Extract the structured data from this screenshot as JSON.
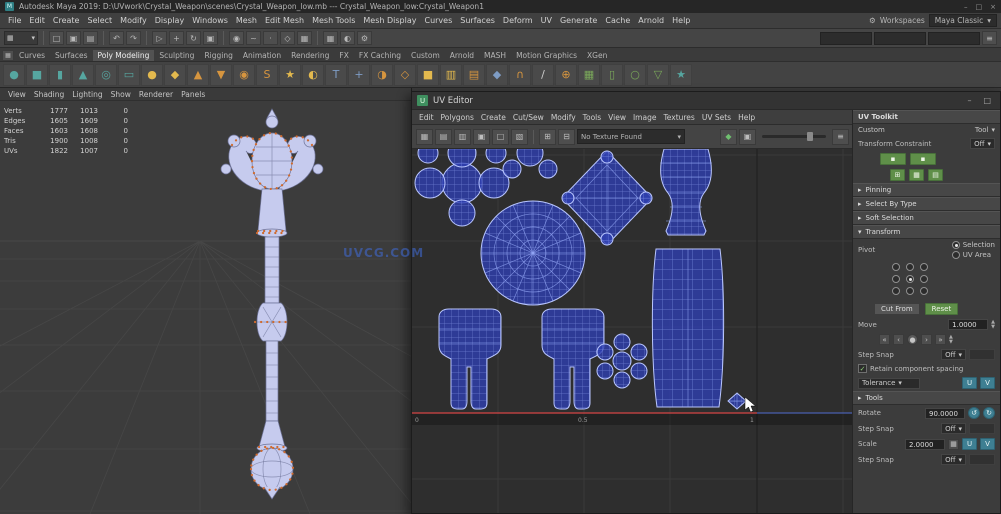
{
  "colors": {
    "shell_fill": "#2e3fb0",
    "shell_line": "#b9c6ff",
    "axis_red": "#b84040",
    "accent_green": "#5f8f49",
    "accent_teal": "#3e7f92",
    "icon_orange": "#d6953f",
    "icon_amber": "#e3b94e",
    "icon_teal": "#56a6a0",
    "icon_blue": "#7e9cc4",
    "watermark_blue": "#3f6cd8"
  },
  "glyphs": {
    "dropdown": "▾",
    "collapsed": "▸",
    "expanded": "▾",
    "up": "▲",
    "down": "▼",
    "chev_left": "‹",
    "chev_right": "›",
    "chev_left2": "«",
    "chev_right2": "»",
    "center_dot": "●",
    "check": "✓",
    "rotate_ccw": "↺",
    "rotate_cw": "↻",
    "minimize": "–",
    "maximize": "□",
    "close": "×",
    "gear": "⚙",
    "grid": "▦",
    "slider_more": "≡"
  },
  "window": {
    "app_icon": "M",
    "title": "Autodesk Maya 2019: D:\\UVwork\\Crystal_Weapon\\scenes\\Crystal_Weapon_low.mb --- Crystal_Weapon_low:Crystal_Weapon1"
  },
  "menubar": {
    "items": [
      "File",
      "Edit",
      "Create",
      "Select",
      "Modify",
      "Display",
      "Windows",
      "Mesh",
      "Edit Mesh",
      "Mesh Tools",
      "Mesh Display",
      "Curves",
      "Surfaces",
      "Deform",
      "UV",
      "Generate",
      "Cache",
      "Arnold",
      "Help"
    ],
    "workspaces_label": "Workspaces",
    "workspace_value": "Maya Classic"
  },
  "statusline": {
    "icons_file": [
      {
        "g": "□",
        "n": "new-scene-icon"
      },
      {
        "g": "▣",
        "n": "open-scene-icon"
      },
      {
        "g": "▤",
        "n": "save-scene-icon"
      }
    ],
    "icons_history": [
      {
        "g": "↶",
        "n": "undo-icon"
      },
      {
        "g": "↷",
        "n": "redo-icon"
      }
    ],
    "icons_select": [
      {
        "g": "▷",
        "n": "select-tool-icon"
      },
      {
        "g": "+",
        "n": "move-tool-icon"
      },
      {
        "g": "↻",
        "n": "rotate-tool-icon"
      },
      {
        "g": "▣",
        "n": "scale-tool-icon"
      }
    ],
    "icons_snap": [
      {
        "g": "◉",
        "n": "snap-to-grid-icon"
      },
      {
        "g": "~",
        "n": "snap-to-curve-icon"
      },
      {
        "g": "·",
        "n": "snap-to-point-icon"
      },
      {
        "g": "◇",
        "n": "snap-to-plane-icon"
      },
      {
        "g": "▦",
        "n": "make-live-icon"
      }
    ],
    "icons_render": [
      {
        "g": "▦",
        "n": "render-icon"
      },
      {
        "g": "◐",
        "n": "ipr-render-icon"
      },
      {
        "g": "⚙",
        "n": "render-settings-icon"
      }
    ],
    "field_values": [
      "",
      "",
      ""
    ]
  },
  "shelf": {
    "tabs": [
      "Curves",
      "Surfaces",
      {
        "label": "Poly Modeling",
        "active": true
      },
      "Sculpting",
      "Rigging",
      "Animation",
      "Rendering",
      "FX",
      "FX Caching",
      "Custom",
      "Arnold",
      "MASH",
      "Motion Graphics",
      "XGen"
    ],
    "icons": [
      {
        "g": "●",
        "c": "#56a6a0",
        "n": "shelf-sphere-icon"
      },
      {
        "g": "■",
        "c": "#56a6a0",
        "n": "shelf-cube-icon"
      },
      {
        "g": "▮",
        "c": "#56a6a0",
        "n": "shelf-cylinder-icon"
      },
      {
        "g": "▲",
        "c": "#56a6a0",
        "n": "shelf-cone-icon"
      },
      {
        "g": "◎",
        "c": "#56a6a0",
        "n": "shelf-torus-icon"
      },
      {
        "g": "▭",
        "c": "#56a6a0",
        "n": "shelf-plane-icon"
      },
      {
        "g": "●",
        "c": "#e3b94e",
        "n": "shelf-disc-icon"
      },
      {
        "g": "◆",
        "c": "#e3b94e",
        "n": "shelf-platonic-icon"
      },
      {
        "g": "▲",
        "c": "#d6953f",
        "n": "shelf-pyramid-icon"
      },
      {
        "g": "▼",
        "c": "#d6953f",
        "n": "shelf-prism-icon"
      },
      {
        "g": "◉",
        "c": "#d6953f",
        "n": "shelf-pipe-icon"
      },
      {
        "g": "S",
        "c": "#d6953f",
        "n": "shelf-helix-icon"
      },
      {
        "g": "★",
        "c": "#e3b94e",
        "n": "shelf-gear-icon"
      },
      {
        "g": "◐",
        "c": "#e3b94e",
        "n": "shelf-soccer-icon"
      },
      {
        "g": "T",
        "c": "#7e9cc4",
        "n": "shelf-type-icon"
      },
      {
        "g": "+",
        "c": "#7e9cc4",
        "n": "shelf-svg-icon"
      },
      {
        "g": "◑",
        "c": "#d6953f",
        "n": "shelf-boolean-union-icon"
      },
      {
        "g": "◇",
        "c": "#d6953f",
        "n": "shelf-boolean-difference-icon"
      },
      {
        "g": "■",
        "c": "#e3b94e",
        "n": "shelf-combine-icon"
      },
      {
        "g": "▥",
        "c": "#e3b94e",
        "n": "shelf-separate-icon"
      },
      {
        "g": "▤",
        "c": "#d6953f",
        "n": "shelf-extrude-icon"
      },
      {
        "g": "◆",
        "c": "#7e9cc4",
        "n": "shelf-bevel-icon"
      },
      {
        "g": "∩",
        "c": "#d6953f",
        "n": "shelf-bridge-icon"
      },
      {
        "g": "/",
        "c": "#cccccc",
        "n": "shelf-multicut-icon"
      },
      {
        "g": "⊕",
        "c": "#d6953f",
        "n": "shelf-target-weld-icon"
      },
      {
        "g": "▦",
        "c": "#7aa85a",
        "n": "shelf-quad-draw-icon"
      },
      {
        "g": "▯",
        "c": "#7aa85a",
        "n": "shelf-mirror-icon"
      },
      {
        "g": "○",
        "c": "#7aa85a",
        "n": "shelf-smooth-icon"
      },
      {
        "g": "▽",
        "c": "#7aa85a",
        "n": "shelf-reduce-icon"
      },
      {
        "g": "★",
        "c": "#56a6a0",
        "n": "shelf-favorites-icon"
      }
    ]
  },
  "viewport": {
    "menus": [
      "View",
      "Shading",
      "Lighting",
      "Show",
      "Renderer",
      "Panels"
    ],
    "polycount": [
      [
        "Verts",
        "1777",
        "1013",
        "0"
      ],
      [
        "Edges",
        "1605",
        "1609",
        "0"
      ],
      [
        "Faces",
        "1603",
        "1608",
        "0"
      ],
      [
        "Tris",
        "1900",
        "1008",
        "0"
      ],
      [
        "UVs",
        "1822",
        "1007",
        "0"
      ]
    ],
    "watermark": "UVCG.COM"
  },
  "uv_editor": {
    "icon": "U",
    "title": "UV Editor",
    "menus": [
      "Edit",
      "Polygons",
      "Create",
      "Cut/Sew",
      "Modify",
      "Tools",
      "View",
      "Image",
      "Textures",
      "UV Sets",
      "Help"
    ],
    "toolbar_icons_left": [
      {
        "g": "▦",
        "n": "uv-grid-toggle-icon"
      },
      {
        "g": "▤",
        "n": "uv-shaded-toggle-icon"
      },
      {
        "g": "▥",
        "n": "uv-wireframe-toggle-icon"
      },
      {
        "g": "▣",
        "n": "uv-texture-toggle-icon"
      },
      {
        "g": "□",
        "n": "uv-borders-toggle-icon"
      },
      {
        "g": "▧",
        "n": "uv-distortion-toggle-icon"
      }
    ],
    "toolbar_icons_mid": [
      {
        "g": "⊞",
        "n": "uv-tile-grid-icon"
      },
      {
        "g": "⊟",
        "n": "uv-pixel-snap-icon"
      }
    ],
    "texture_dropdown": "No Texture Found",
    "toolbar_icons_right": [
      {
        "g": "◆",
        "n": "isolate-select-icon",
        "c": "#6fbf6f"
      },
      {
        "g": "▣",
        "n": "image-ratio-icon"
      }
    ],
    "ticks": [
      "0",
      "0.5",
      "1"
    ]
  },
  "toolkit": {
    "title": "UV Toolkit",
    "tab_left": "Custom",
    "tab_right": "Tool",
    "constraint_label": "Transform Constraint",
    "constraint_value": "Off",
    "quick_row1": [
      {
        "g": "▪",
        "n": "uv-cut-quick-button"
      },
      {
        "g": "▪",
        "n": "uv-sew-quick-button"
      }
    ],
    "quick_row2": [
      {
        "g": "⊞",
        "n": "uv-grid-quick-button"
      },
      {
        "g": "▦",
        "n": "uv-checker-quick-button"
      },
      {
        "g": "▤",
        "n": "uv-shade-quick-button"
      }
    ],
    "sections": [
      "Pinning",
      "Select By Type",
      "Soft Selection"
    ],
    "transform_header": "Transform",
    "pivot_label": "Pivot",
    "radio1": "Selection",
    "radio2": "UV Area",
    "btn_cut": "Cut From",
    "btn_reset": "Reset",
    "move_label": "Move",
    "move_value": "1.0000",
    "step_label": "Step Snap",
    "step_value": "Off",
    "retain_label": "Retain component spacing",
    "tolerance_label": "Tolerance",
    "u": "U",
    "v": "V",
    "tools_header": "Tools",
    "rotate_label": "Rotate",
    "rotate_value": "90.0000",
    "scale_label": "Scale",
    "scale_value": "2.0000"
  }
}
